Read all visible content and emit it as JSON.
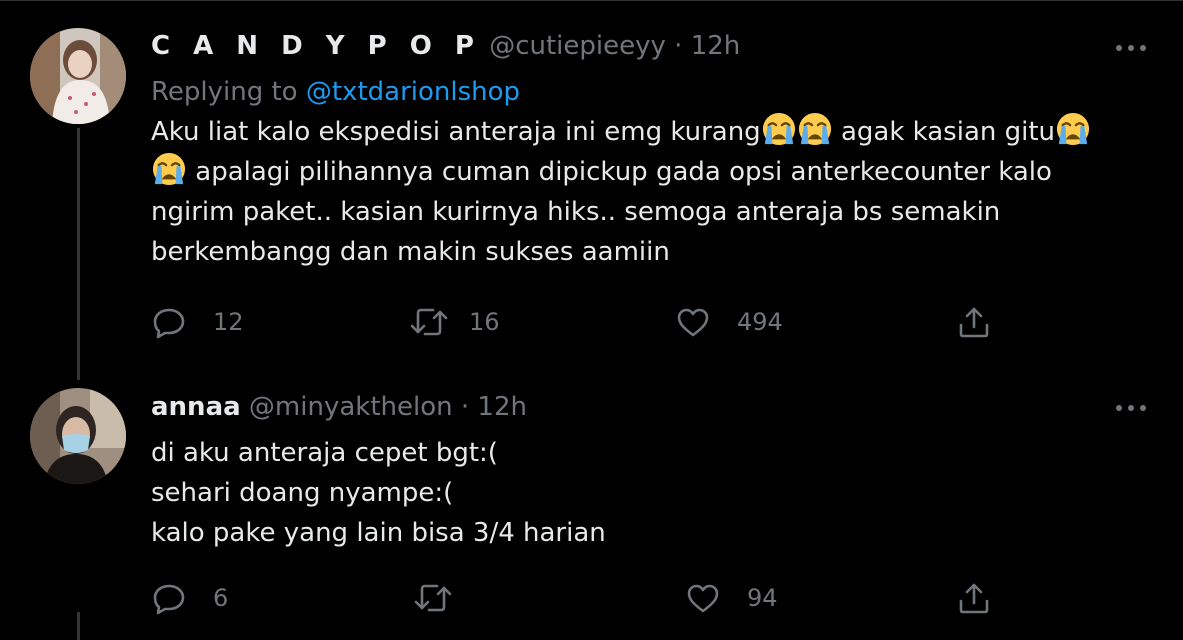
{
  "tweets": [
    {
      "display_name": "C A N D Y P O P",
      "handle": "@cutiepieeyy",
      "separator": "·",
      "time": "12h",
      "replying_prefix": "Replying to",
      "replying_to": "@txtdarionlshop",
      "text_segments": [
        "Aku liat kalo ekspedisi anteraja ini emg kurang",
        " agak kasian gitu",
        " apalagi pilihannya cuman dipickup gada opsi anterkecounter kalo ngirim paket.. kasian kurirnya hiks.. semoga anteraja bs semakin berkembangg dan makin sukses aamiin"
      ],
      "emoji": "loudly-crying-face",
      "reply_count": "12",
      "retweet_count": "16",
      "like_count": "494"
    },
    {
      "display_name": "annaa",
      "handle": "@minyakthelon",
      "separator": "·",
      "time": "12h",
      "lines": [
        "di aku anteraja cepet bgt:(",
        "sehari doang nyampe:(",
        "kalo pake yang lain bisa 3/4 harian"
      ],
      "reply_count": "6",
      "retweet_count": "",
      "like_count": "94"
    }
  ],
  "colors": {
    "background": "#000000",
    "text": "#e7e9ea",
    "muted": "#71767b",
    "link": "#1d9bf0",
    "thread_line": "#333639"
  },
  "icons": [
    "more-icon",
    "reply-icon",
    "retweet-icon",
    "like-icon",
    "share-icon"
  ]
}
